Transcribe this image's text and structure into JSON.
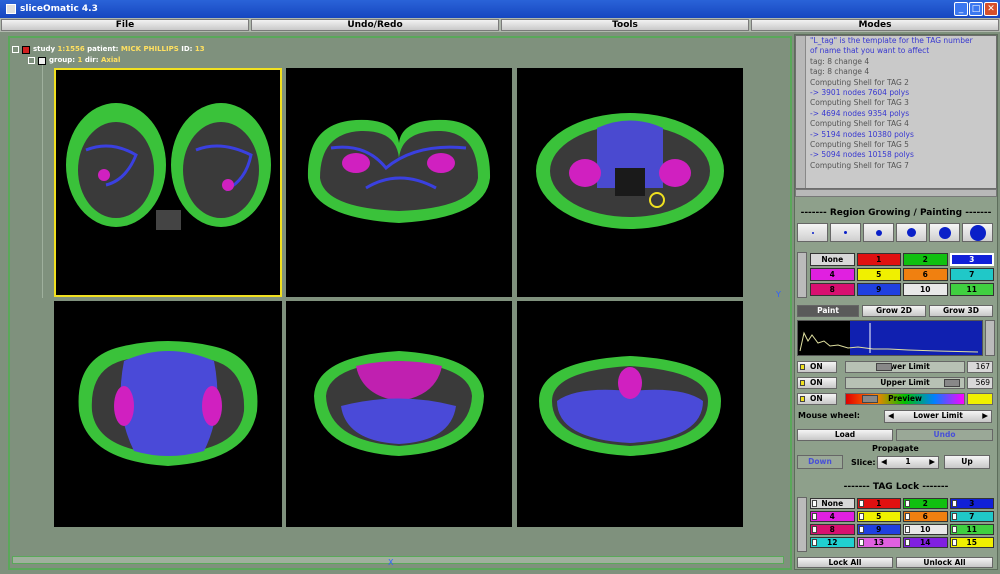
{
  "window": {
    "title": "sliceOmatic 4.3",
    "min": "_",
    "max": "□",
    "close": "✕"
  },
  "menu": [
    "File",
    "Undo/Redo",
    "Tools",
    "Modes"
  ],
  "tree": {
    "study_label": "study",
    "study_num": "1",
    "study_sep": ":",
    "study_id": "1556",
    "patient_label": "patient:",
    "patient": "MICK PHILLIPS",
    "id_label": "ID:",
    "id": "13",
    "group_label": "group:",
    "group": "1",
    "dir_label": "dir:",
    "dir": "Axial"
  },
  "axes": {
    "y": "Y",
    "x": "X"
  },
  "log": [
    {
      "t": "\"L_tag\" is the template for the TAG number",
      "c": "b"
    },
    {
      "t": "of name that you want to affect",
      "c": "b"
    },
    {
      "t": "tag: 8 change 4",
      "c": "g"
    },
    {
      "t": "tag: 8 change 4",
      "c": "g"
    },
    {
      "t": "Computing Shell for TAG 2",
      "c": "g"
    },
    {
      "t": "-> 3901 nodes 7604 polys",
      "c": "b"
    },
    {
      "t": "Computing Shell for TAG 3",
      "c": "g"
    },
    {
      "t": "-> 4694 nodes 9354 polys",
      "c": "b"
    },
    {
      "t": "Computing Shell for TAG 4",
      "c": "g"
    },
    {
      "t": "-> 5194 nodes 10380 polys",
      "c": "b"
    },
    {
      "t": "Computing Shell for TAG 5",
      "c": "g"
    },
    {
      "t": "-> 5094 nodes 10158 polys",
      "c": "b"
    },
    {
      "t": "Computing Shell for TAG 7",
      "c": "g"
    }
  ],
  "region": {
    "title": "------- Region Growing / Painting -------"
  },
  "brush_sizes": [
    2,
    3,
    6,
    9,
    12,
    16
  ],
  "tags": [
    {
      "label": "None",
      "bg": "#d8d8d8",
      "fg": "#000"
    },
    {
      "label": "1",
      "bg": "#e01010",
      "fg": "#000"
    },
    {
      "label": "2",
      "bg": "#10c010",
      "fg": "#000"
    },
    {
      "label": "3",
      "bg": "#1020d8",
      "fg": "#fff",
      "sel": true
    },
    {
      "label": "4",
      "bg": "#e020e0",
      "fg": "#000"
    },
    {
      "label": "5",
      "bg": "#f0f000",
      "fg": "#000"
    },
    {
      "label": "6",
      "bg": "#f08010",
      "fg": "#000"
    },
    {
      "label": "7",
      "bg": "#20c8c8",
      "fg": "#000"
    },
    {
      "label": "8",
      "bg": "#d81070",
      "fg": "#000"
    },
    {
      "label": "9",
      "bg": "#2040e0",
      "fg": "#000"
    },
    {
      "label": "10",
      "bg": "#e8e8e8",
      "fg": "#000"
    },
    {
      "label": "11",
      "bg": "#40d040",
      "fg": "#000"
    }
  ],
  "modes": {
    "paint": "Paint",
    "grow2d": "Grow 2D",
    "grow3d": "Grow 3D"
  },
  "limits": {
    "on": "ON",
    "lower_label": "Lower Limit",
    "lower": "167",
    "upper_label": "Upper Limit",
    "upper": "569",
    "preview": "Preview"
  },
  "mouse": {
    "label": "Mouse wheel:",
    "value": "Lower Limit"
  },
  "actions": {
    "load": "Load",
    "undo": "Undo"
  },
  "propagate": {
    "title": "Propagate",
    "down": "Down",
    "slice_label": "Slice:",
    "slice": "1",
    "up": "Up"
  },
  "taglock": {
    "title": "------- TAG Lock -------",
    "lock_all": "Lock All",
    "unlock_all": "Unlock All"
  },
  "locktags": [
    {
      "label": "None",
      "bg": "#d8d8d8"
    },
    {
      "label": "1",
      "bg": "#e01010"
    },
    {
      "label": "2",
      "bg": "#10c010"
    },
    {
      "label": "3",
      "bg": "#1020d8"
    },
    {
      "label": "4",
      "bg": "#e020e0"
    },
    {
      "label": "5",
      "bg": "#f0f000"
    },
    {
      "label": "6",
      "bg": "#f08010"
    },
    {
      "label": "7",
      "bg": "#20c8c8"
    },
    {
      "label": "8",
      "bg": "#d81070"
    },
    {
      "label": "9",
      "bg": "#2040e0"
    },
    {
      "label": "10",
      "bg": "#e8e8e8"
    },
    {
      "label": "11",
      "bg": "#40d040"
    },
    {
      "label": "12",
      "bg": "#20d0d0"
    },
    {
      "label": "13",
      "bg": "#e060e0"
    },
    {
      "label": "14",
      "bg": "#8020e0"
    },
    {
      "label": "15",
      "bg": "#f0f000"
    }
  ]
}
